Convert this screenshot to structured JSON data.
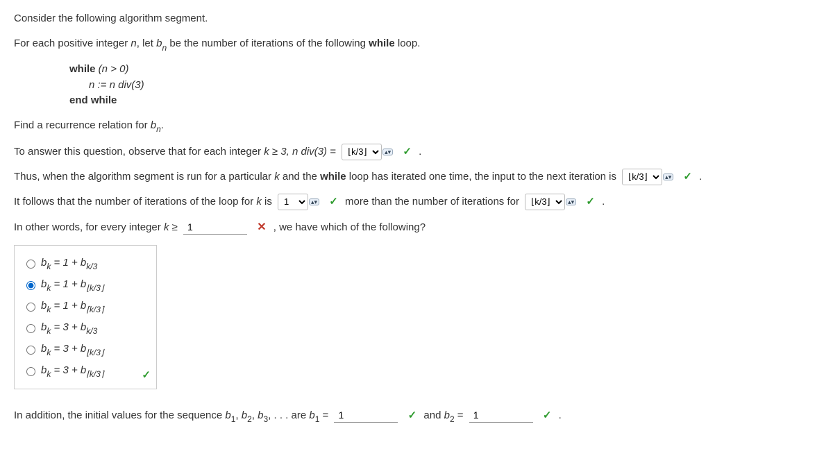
{
  "intro": {
    "line1": "Consider the following algorithm segment.",
    "line2a": "For each positive integer ",
    "line2_n": "n",
    "line2b": ", let ",
    "line2_bn_b": "b",
    "line2_bn_n": "n",
    "line2c": " be the number of iterations of the following ",
    "line2_while": "while",
    "line2d": " loop."
  },
  "code": {
    "while_kw": "while",
    "cond": " (n > 0)",
    "assign": "n := n div(3)",
    "end_kw": "end while"
  },
  "q1": {
    "a": "Find a recurrence relation for ",
    "b": "b",
    "n": "n",
    "dot": "."
  },
  "line_observe": {
    "a": "To answer this question, observe that for each integer ",
    "k3": "k ≥ 3, ",
    "ndiv": "n div(3) =  ",
    "sel_val": "⌊k/3⌋",
    "dot": " ."
  },
  "line_thus": {
    "a": "Thus, when the algorithm segment is run for a particular ",
    "k": "k",
    "b": " and the ",
    "while": "while",
    "c": " loop has iterated one time, the input to the next iteration is  ",
    "sel_val": "⌊k/3⌋",
    "dot": " ."
  },
  "line_follows": {
    "a": "It follows that the number of iterations of the loop for ",
    "k": "k",
    "b": " is ",
    "sel1_val": "1",
    "c": " more than the number of iterations for  ",
    "sel2_val": "⌊k/3⌋",
    "dot": " ."
  },
  "line_other": {
    "a": "In other words, for every integer ",
    "k": "k ≥ ",
    "input_val": "1",
    "b": " , we have which of the following?"
  },
  "options": [
    {
      "prefix": "b",
      "sub1": "k",
      "mid": " = 1 + ",
      "b2": "b",
      "sub2": "k/3",
      "checked": false
    },
    {
      "prefix": "b",
      "sub1": "k",
      "mid": " = 1 + ",
      "b2": "b",
      "sub2": "⌊k/3⌋",
      "checked": true
    },
    {
      "prefix": "b",
      "sub1": "k",
      "mid": " = 1 + ",
      "b2": "b",
      "sub2": "⌈k/3⌉",
      "checked": false
    },
    {
      "prefix": "b",
      "sub1": "k",
      "mid": " = 3 + ",
      "b2": "b",
      "sub2": "k/3",
      "checked": false
    },
    {
      "prefix": "b",
      "sub1": "k",
      "mid": " = 3 + ",
      "b2": "b",
      "sub2": "⌊k/3⌋",
      "checked": false
    },
    {
      "prefix": "b",
      "sub1": "k",
      "mid": " = 3 + ",
      "b2": "b",
      "sub2": "⌈k/3⌉",
      "checked": false
    }
  ],
  "line_initial": {
    "a": "In addition, the initial values for the sequence ",
    "b1": "b",
    "s1": "1",
    "c1": ", ",
    "b2": "b",
    "s2": "2",
    "c2": ", ",
    "b3": "b",
    "s3": "3",
    "c3": ", . . . are ",
    "bv1": "b",
    "sv1": "1",
    "eq1": " = ",
    "val1": "1",
    "and": " and ",
    "bv2": "b",
    "sv2": "2",
    "eq2": " = ",
    "val2": "1",
    "dot": " ."
  },
  "icon_check": "✓",
  "icon_x": "✕",
  "arrows": "▴▾"
}
